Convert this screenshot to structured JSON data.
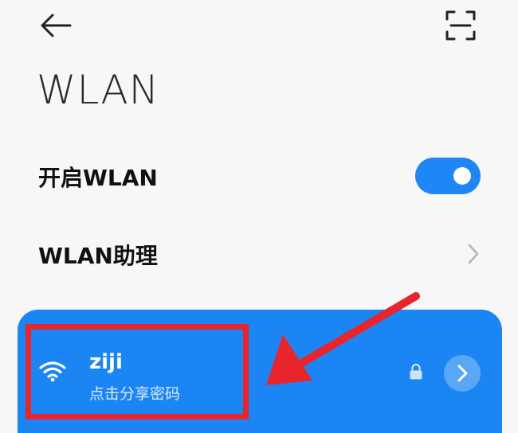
{
  "header": {
    "title": "WLAN",
    "back_icon": "arrow-left-icon",
    "scan_icon": "scan-icon"
  },
  "settings": {
    "wlan_toggle": {
      "label": "开启WLAN",
      "on": true
    },
    "assistant": {
      "label": "WLAN助理"
    }
  },
  "network": {
    "ssid": "ziji",
    "subtitle": "点击分享密码",
    "secured": true
  },
  "colors": {
    "accent": "#1f86f5",
    "annotation": "#e8242c",
    "background": "#f7f7f7"
  }
}
